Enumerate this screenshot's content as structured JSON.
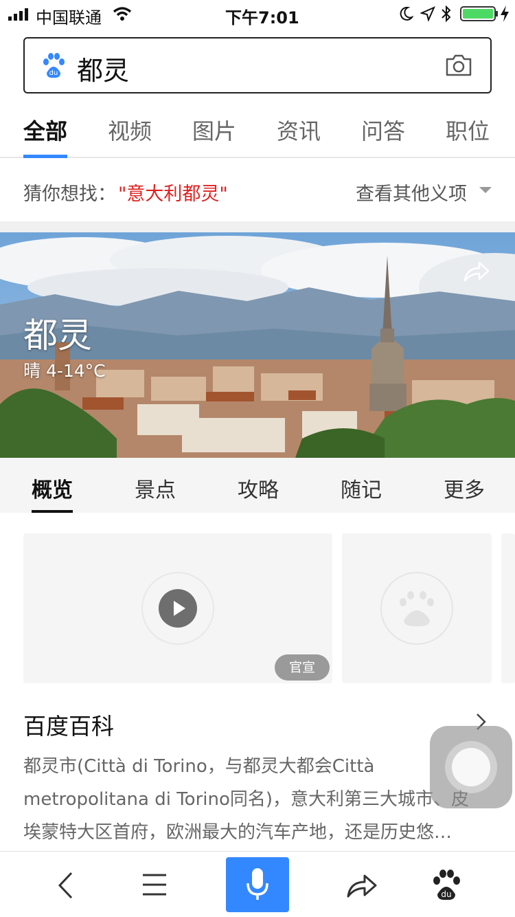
{
  "status": {
    "carrier": "中国联通",
    "time": "下午7:01"
  },
  "search": {
    "query": "都灵"
  },
  "category_tabs": [
    "全部",
    "视频",
    "图片",
    "资讯",
    "问答",
    "职位"
  ],
  "guess": {
    "prefix": "猜你想找：",
    "term": "\"意大利都灵\"",
    "other_meanings": "查看其他义项"
  },
  "hero": {
    "title": "都灵",
    "weather": "晴 4-14°C"
  },
  "sub_tabs": [
    "概览",
    "景点",
    "攻略",
    "随记",
    "更多"
  ],
  "media": {
    "badge": "官宣"
  },
  "baike": {
    "title": "百度百科",
    "lines": [
      "都灵市(Città di Torino，与都灵大都会Città",
      "metropolitana di Torino同名)，意大利第三大城市、皮",
      "埃蒙特大区首府，欧洲最大的汽车产地，还是历史悠…"
    ]
  },
  "icons": {
    "search_logo": "baidu-paw-icon",
    "camera": "camera-icon",
    "share": "share-icon",
    "play": "play-icon",
    "back": "back-icon",
    "menu": "menu-icon",
    "mic": "mic-icon",
    "bottom_share": "share-icon",
    "home": "baidu-home-icon"
  },
  "colors": {
    "accent": "#3388ff",
    "highlight": "#e02020",
    "battery": "#4cd964"
  }
}
